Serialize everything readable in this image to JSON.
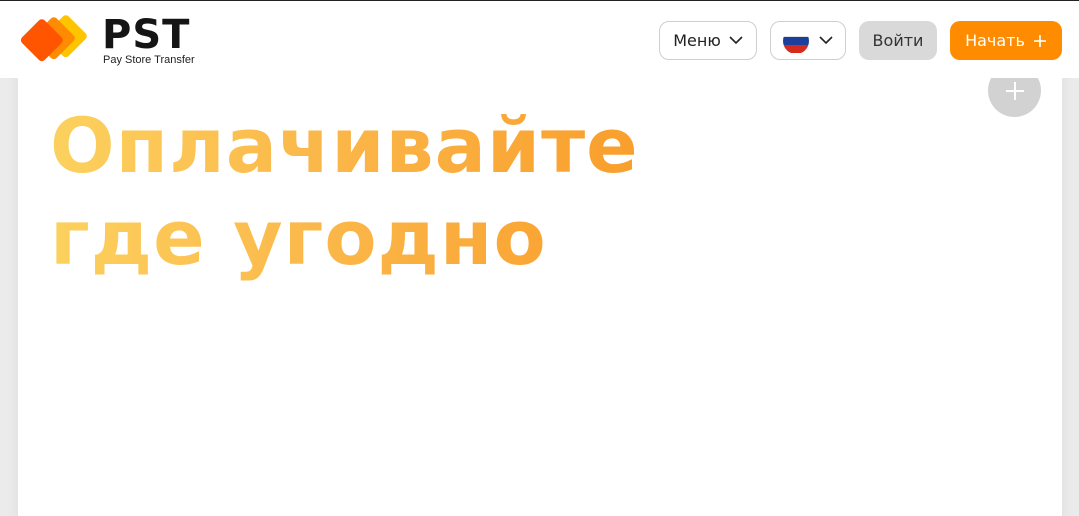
{
  "brand": {
    "name": "PST",
    "tagline": "Pay Store Transfer",
    "colors": [
      "#ff5400",
      "#ff8c00",
      "#ffc400"
    ]
  },
  "header": {
    "menu_label": "Меню",
    "menu_icon": "chevron-down-icon",
    "language_icon": "russia-flag-icon",
    "login_label": "Войти",
    "start_label": "Начать",
    "start_icon": "plus-icon",
    "accent_color": "#ff8c00"
  },
  "hero": {
    "title_line1": "Оплачивайте",
    "title_line2": "где угодно",
    "expand_icon": "plus-icon"
  }
}
